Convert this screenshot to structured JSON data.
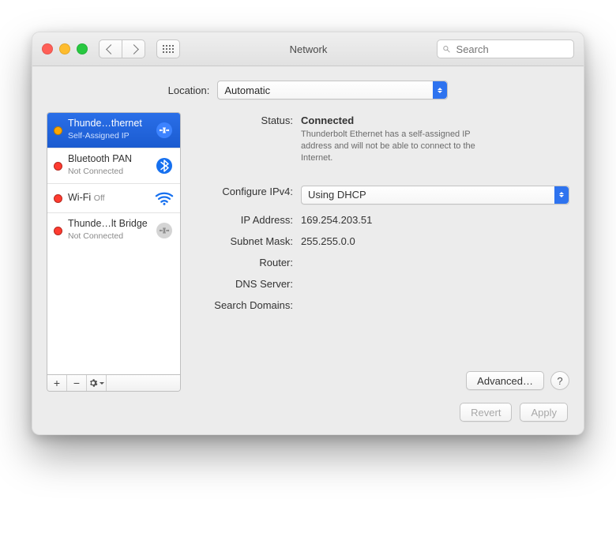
{
  "window": {
    "title": "Network"
  },
  "toolbar": {
    "search_placeholder": "Search"
  },
  "location": {
    "label": "Location:",
    "value": "Automatic"
  },
  "sidebar": {
    "services": [
      {
        "name": "Thunde…thernet",
        "sub": "Self-Assigned IP",
        "status": "orange",
        "icon": "ethernet",
        "selected": true
      },
      {
        "name": "Bluetooth PAN",
        "sub": "Not Connected",
        "status": "red",
        "icon": "bluetooth",
        "selected": false
      },
      {
        "name": "Wi-Fi",
        "sub": "Off",
        "status": "red",
        "icon": "wifi",
        "selected": false
      },
      {
        "name": "Thunde…lt Bridge",
        "sub": "Not Connected",
        "status": "red",
        "icon": "ethernet-dim",
        "selected": false
      }
    ],
    "footer": {
      "add": "+",
      "remove": "−",
      "gear": "✱"
    }
  },
  "detail": {
    "status_label": "Status:",
    "status_value": "Connected",
    "status_detail": "Thunderbolt Ethernet has a self-assigned IP address and will not be able to connect to the Internet.",
    "configure_label": "Configure IPv4:",
    "configure_value": "Using DHCP",
    "ip_label": "IP Address:",
    "ip_value": "169.254.203.51",
    "subnet_label": "Subnet Mask:",
    "subnet_value": "255.255.0.0",
    "router_label": "Router:",
    "router_value": "",
    "dns_label": "DNS Server:",
    "dns_value": "",
    "search_domains_label": "Search Domains:",
    "search_domains_value": "",
    "advanced": "Advanced…",
    "help": "?"
  },
  "footer": {
    "revert": "Revert",
    "apply": "Apply"
  }
}
